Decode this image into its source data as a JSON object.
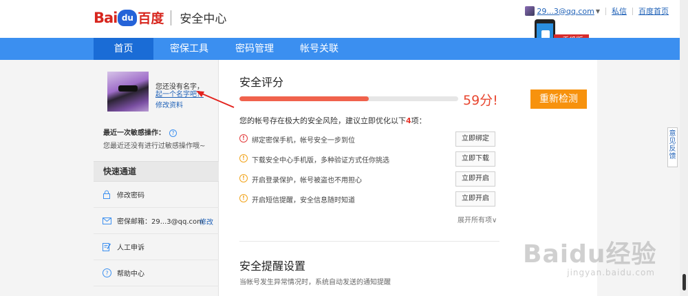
{
  "header": {
    "brand_latin": "Bai",
    "brand_paw": "du",
    "brand_cn": "百度",
    "brand_section": "安全中心"
  },
  "user_menu": {
    "username": "29...3@qq.com",
    "messages": "私信",
    "home": "百度首页"
  },
  "promo": {
    "ribbon_text": "手机版"
  },
  "nav": {
    "items": [
      {
        "label": "首页",
        "active": true
      },
      {
        "label": "密保工具"
      },
      {
        "label": "密码管理"
      },
      {
        "label": "帐号关联"
      }
    ]
  },
  "profile": {
    "no_name": "您还没有名字，",
    "give_name_link": "起一个名字吧？",
    "edit_profile": "修改资料",
    "last_op_title": "最近一次敏感操作：",
    "last_op_help": "?",
    "last_op_desc": "您最近还没有进行过敏感操作哦~"
  },
  "quick_access": {
    "title": "快速通道",
    "items": [
      {
        "label": "修改密码",
        "icon": "lock-icon"
      },
      {
        "label": "密保邮箱：29...3@qq.com",
        "action": "修改",
        "icon": "mail-icon"
      },
      {
        "label": "人工申诉",
        "icon": "edit-icon"
      },
      {
        "label": "帮助中心",
        "icon": "help-icon"
      }
    ]
  },
  "security_score": {
    "title": "安全评分",
    "score_text": "59分!",
    "score": 59,
    "recheck": "重新检测",
    "risk_prefix": "您的帐号存在极大的安全风险，建议立即优化以下",
    "risk_count": "4",
    "risk_suffix": "项：",
    "tasks": [
      {
        "label": "绑定密保手机，帐号安全一步到位",
        "action": "立即绑定",
        "level": "red",
        "icon": "alert-red-icon"
      },
      {
        "label": "下载安全中心手机版，多种验证方式任你挑选",
        "action": "立即下载",
        "level": "yellow",
        "icon": "alert-yellow-icon"
      },
      {
        "label": "开启登录保护，帐号被盗也不用担心",
        "action": "立即开启",
        "level": "yellow",
        "icon": "alert-yellow-icon"
      },
      {
        "label": "开启短信提醒，安全信息随时知道",
        "action": "立即开启",
        "level": "yellow",
        "icon": "alert-yellow-icon"
      }
    ],
    "expand_all": "展开所有项∨"
  },
  "alert_settings": {
    "title": "安全提醒设置",
    "desc": "当帐号发生异常情况时，系统自动发送的通知提醒"
  },
  "feedback_tab": "意见反馈",
  "watermark": {
    "logo": "Baidu经验",
    "url": "jingyan.baidu.com"
  },
  "colors": {
    "nav_bg": "#3b8ff0",
    "nav_active": "#1a6cd6",
    "score_fill": "#f0624c",
    "recheck_button": "#f7920d",
    "brand_red": "#d7261e",
    "link_blue": "#2263b8"
  }
}
